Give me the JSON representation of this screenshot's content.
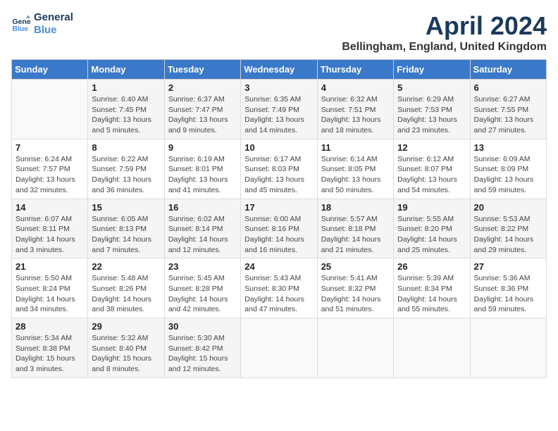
{
  "logo": {
    "line1": "General",
    "line2": "Blue"
  },
  "calendar": {
    "title": "April 2024",
    "subtitle": "Bellingham, England, United Kingdom"
  },
  "days_of_week": [
    "Sunday",
    "Monday",
    "Tuesday",
    "Wednesday",
    "Thursday",
    "Friday",
    "Saturday"
  ],
  "weeks": [
    [
      {
        "day": "",
        "detail": ""
      },
      {
        "day": "1",
        "detail": "Sunrise: 6:40 AM\nSunset: 7:45 PM\nDaylight: 13 hours\nand 5 minutes."
      },
      {
        "day": "2",
        "detail": "Sunrise: 6:37 AM\nSunset: 7:47 PM\nDaylight: 13 hours\nand 9 minutes."
      },
      {
        "day": "3",
        "detail": "Sunrise: 6:35 AM\nSunset: 7:49 PM\nDaylight: 13 hours\nand 14 minutes."
      },
      {
        "day": "4",
        "detail": "Sunrise: 6:32 AM\nSunset: 7:51 PM\nDaylight: 13 hours\nand 18 minutes."
      },
      {
        "day": "5",
        "detail": "Sunrise: 6:29 AM\nSunset: 7:53 PM\nDaylight: 13 hours\nand 23 minutes."
      },
      {
        "day": "6",
        "detail": "Sunrise: 6:27 AM\nSunset: 7:55 PM\nDaylight: 13 hours\nand 27 minutes."
      }
    ],
    [
      {
        "day": "7",
        "detail": "Sunrise: 6:24 AM\nSunset: 7:57 PM\nDaylight: 13 hours\nand 32 minutes."
      },
      {
        "day": "8",
        "detail": "Sunrise: 6:22 AM\nSunset: 7:59 PM\nDaylight: 13 hours\nand 36 minutes."
      },
      {
        "day": "9",
        "detail": "Sunrise: 6:19 AM\nSunset: 8:01 PM\nDaylight: 13 hours\nand 41 minutes."
      },
      {
        "day": "10",
        "detail": "Sunrise: 6:17 AM\nSunset: 8:03 PM\nDaylight: 13 hours\nand 45 minutes."
      },
      {
        "day": "11",
        "detail": "Sunrise: 6:14 AM\nSunset: 8:05 PM\nDaylight: 13 hours\nand 50 minutes."
      },
      {
        "day": "12",
        "detail": "Sunrise: 6:12 AM\nSunset: 8:07 PM\nDaylight: 13 hours\nand 54 minutes."
      },
      {
        "day": "13",
        "detail": "Sunrise: 6:09 AM\nSunset: 8:09 PM\nDaylight: 13 hours\nand 59 minutes."
      }
    ],
    [
      {
        "day": "14",
        "detail": "Sunrise: 6:07 AM\nSunset: 8:11 PM\nDaylight: 14 hours\nand 3 minutes."
      },
      {
        "day": "15",
        "detail": "Sunrise: 6:05 AM\nSunset: 8:13 PM\nDaylight: 14 hours\nand 7 minutes."
      },
      {
        "day": "16",
        "detail": "Sunrise: 6:02 AM\nSunset: 8:14 PM\nDaylight: 14 hours\nand 12 minutes."
      },
      {
        "day": "17",
        "detail": "Sunrise: 6:00 AM\nSunset: 8:16 PM\nDaylight: 14 hours\nand 16 minutes."
      },
      {
        "day": "18",
        "detail": "Sunrise: 5:57 AM\nSunset: 8:18 PM\nDaylight: 14 hours\nand 21 minutes."
      },
      {
        "day": "19",
        "detail": "Sunrise: 5:55 AM\nSunset: 8:20 PM\nDaylight: 14 hours\nand 25 minutes."
      },
      {
        "day": "20",
        "detail": "Sunrise: 5:53 AM\nSunset: 8:22 PM\nDaylight: 14 hours\nand 29 minutes."
      }
    ],
    [
      {
        "day": "21",
        "detail": "Sunrise: 5:50 AM\nSunset: 8:24 PM\nDaylight: 14 hours\nand 34 minutes."
      },
      {
        "day": "22",
        "detail": "Sunrise: 5:48 AM\nSunset: 8:26 PM\nDaylight: 14 hours\nand 38 minutes."
      },
      {
        "day": "23",
        "detail": "Sunrise: 5:45 AM\nSunset: 8:28 PM\nDaylight: 14 hours\nand 42 minutes."
      },
      {
        "day": "24",
        "detail": "Sunrise: 5:43 AM\nSunset: 8:30 PM\nDaylight: 14 hours\nand 47 minutes."
      },
      {
        "day": "25",
        "detail": "Sunrise: 5:41 AM\nSunset: 8:32 PM\nDaylight: 14 hours\nand 51 minutes."
      },
      {
        "day": "26",
        "detail": "Sunrise: 5:39 AM\nSunset: 8:34 PM\nDaylight: 14 hours\nand 55 minutes."
      },
      {
        "day": "27",
        "detail": "Sunrise: 5:36 AM\nSunset: 8:36 PM\nDaylight: 14 hours\nand 59 minutes."
      }
    ],
    [
      {
        "day": "28",
        "detail": "Sunrise: 5:34 AM\nSunset: 8:38 PM\nDaylight: 15 hours\nand 3 minutes."
      },
      {
        "day": "29",
        "detail": "Sunrise: 5:32 AM\nSunset: 8:40 PM\nDaylight: 15 hours\nand 8 minutes."
      },
      {
        "day": "30",
        "detail": "Sunrise: 5:30 AM\nSunset: 8:42 PM\nDaylight: 15 hours\nand 12 minutes."
      },
      {
        "day": "",
        "detail": ""
      },
      {
        "day": "",
        "detail": ""
      },
      {
        "day": "",
        "detail": ""
      },
      {
        "day": "",
        "detail": ""
      }
    ]
  ]
}
